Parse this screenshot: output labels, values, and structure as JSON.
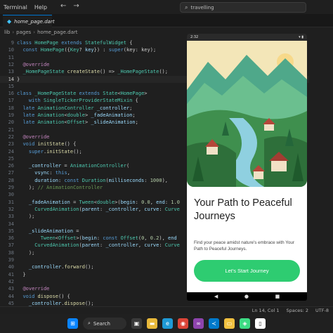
{
  "menu": {
    "items": [
      "Terminal",
      "Help"
    ]
  },
  "search": {
    "text": "travelling"
  },
  "tab": {
    "label": "home_page.dart"
  },
  "breadcrumb": [
    "lib",
    "pages",
    "home_page.dart"
  ],
  "editor": {
    "lines": [
      {
        "n": "9",
        "html": "<span class='kw'>class</span> <span class='ty'>HomePage</span> <span class='kw'>extends</span> <span class='ty'>StatefulWidget</span> {"
      },
      {
        "n": "10",
        "html": "  <span class='kw'>const</span> <span class='ty'>HomePage</span>({<span class='ty'>Key</span>? <span class='pr'>key</span>}) : <span class='kw'>super</span>(key: key);"
      },
      {
        "n": "11",
        "html": ""
      },
      {
        "n": "12",
        "html": "  <span class='an'>@override</span>"
      },
      {
        "n": "13",
        "html": "  <span class='ty'>_HomePageState</span> <span class='fn'>createState</span>() =&gt; <span class='ty'>_HomePageState</span>();"
      },
      {
        "n": "14",
        "html": "}"
      },
      {
        "n": "15",
        "html": ""
      },
      {
        "n": "16",
        "html": "<span class='kw'>class</span> <span class='ty'>_HomePageState</span> <span class='kw'>extends</span> <span class='ty'>State</span>&lt;<span class='ty'>HomePage</span>&gt;"
      },
      {
        "n": "17",
        "html": "    <span class='kw'>with</span> <span class='ty'>SingleTickerProviderStateMixin</span> {"
      },
      {
        "n": "18",
        "html": "  <span class='kw'>late</span> <span class='ty'>AnimationController</span> <span class='pr'>_controller</span>;"
      },
      {
        "n": "19",
        "html": "  <span class='kw'>late</span> <span class='ty'>Animation</span>&lt;<span class='ty'>double</span>&gt; <span class='pr'>_fadeAnimation</span>;"
      },
      {
        "n": "20",
        "html": "  <span class='kw'>late</span> <span class='ty'>Animation</span>&lt;<span class='ty'>Offset</span>&gt; <span class='pr'>_slideAnimation</span>;"
      },
      {
        "n": "21",
        "html": ""
      },
      {
        "n": "22",
        "html": "  <span class='an'>@override</span>"
      },
      {
        "n": "23",
        "html": "  <span class='kw'>void</span> <span class='fn'>initState</span>() {"
      },
      {
        "n": "24",
        "html": "    <span class='kw'>super</span>.<span class='fn'>initState</span>();"
      },
      {
        "n": "25",
        "html": ""
      },
      {
        "n": "26",
        "html": "    <span class='pr'>_controller</span> = <span class='ty'>AnimationController</span>("
      },
      {
        "n": "27",
        "html": "      <span class='pr'>vsync</span>: <span class='kw'>this</span>,"
      },
      {
        "n": "28",
        "html": "      <span class='pr'>duration</span>: <span class='kw'>const</span> <span class='ty'>Duration</span>(<span class='pr'>milliseconds</span>: <span class='nu'>1000</span>),"
      },
      {
        "n": "29",
        "html": "    ); <span class='cm'>// AnimationController</span>"
      },
      {
        "n": "30",
        "html": ""
      },
      {
        "n": "31",
        "html": "    <span class='pr'>_fadeAnimation</span> = <span class='ty'>Tween</span>&lt;<span class='ty'>double</span>&gt;(<span class='pr'>begin</span>: <span class='nu'>0.0</span>, <span class='pr'>end</span>: <span class='nu'>1.0</span>"
      },
      {
        "n": "32",
        "html": "      <span class='ty'>CurvedAnimation</span>(<span class='pr'>parent</span>: <span class='pr'>_controller</span>, <span class='pr'>curve</span>: <span class='ty'>Curve</span>"
      },
      {
        "n": "33",
        "html": "    );"
      },
      {
        "n": "34",
        "html": ""
      },
      {
        "n": "35",
        "html": "    <span class='pr'>_slideAnimation</span> ="
      },
      {
        "n": "36",
        "html": "        <span class='ty'>Tween</span>&lt;<span class='ty'>Offset</span>&gt;(<span class='pr'>begin</span>: <span class='kw'>const</span> <span class='ty'>Offset</span>(<span class='nu'>0</span>, <span class='nu'>0.2</span>), <span class='pr'>end</span>"
      },
      {
        "n": "37",
        "html": "      <span class='ty'>CurvedAnimation</span>(<span class='pr'>parent</span>: <span class='pr'>_controller</span>, <span class='pr'>curve</span>: <span class='ty'>Curve</span>"
      },
      {
        "n": "38",
        "html": "    );"
      },
      {
        "n": "39",
        "html": ""
      },
      {
        "n": "40",
        "html": "    <span class='pr'>_controller</span>.<span class='fn'>forward</span>();"
      },
      {
        "n": "41",
        "html": "  }"
      },
      {
        "n": "42",
        "html": ""
      },
      {
        "n": "43",
        "html": "  <span class='an'>@override</span>"
      },
      {
        "n": "44",
        "html": "  <span class='kw'>void</span> <span class='fn'>dispose</span>() {"
      },
      {
        "n": "45",
        "html": "    <span class='pr'>_controller</span>.<span class='fn'>dispose</span>();"
      }
    ],
    "active_line": "14"
  },
  "phone": {
    "time": "2:32",
    "headline": "Your Path to Peaceful Journeys",
    "subtext": "Find your peace amidst nature's embrace with Your Path to Peaceful Journeys.",
    "cta_label": "Let's Start Journey",
    "cta_color": "#2ecc71"
  },
  "status": {
    "position": "Ln 14, Col 1",
    "spaces": "Spaces: 2",
    "encoding": "UTF-8"
  },
  "taskbar": {
    "search_label": "Search"
  }
}
